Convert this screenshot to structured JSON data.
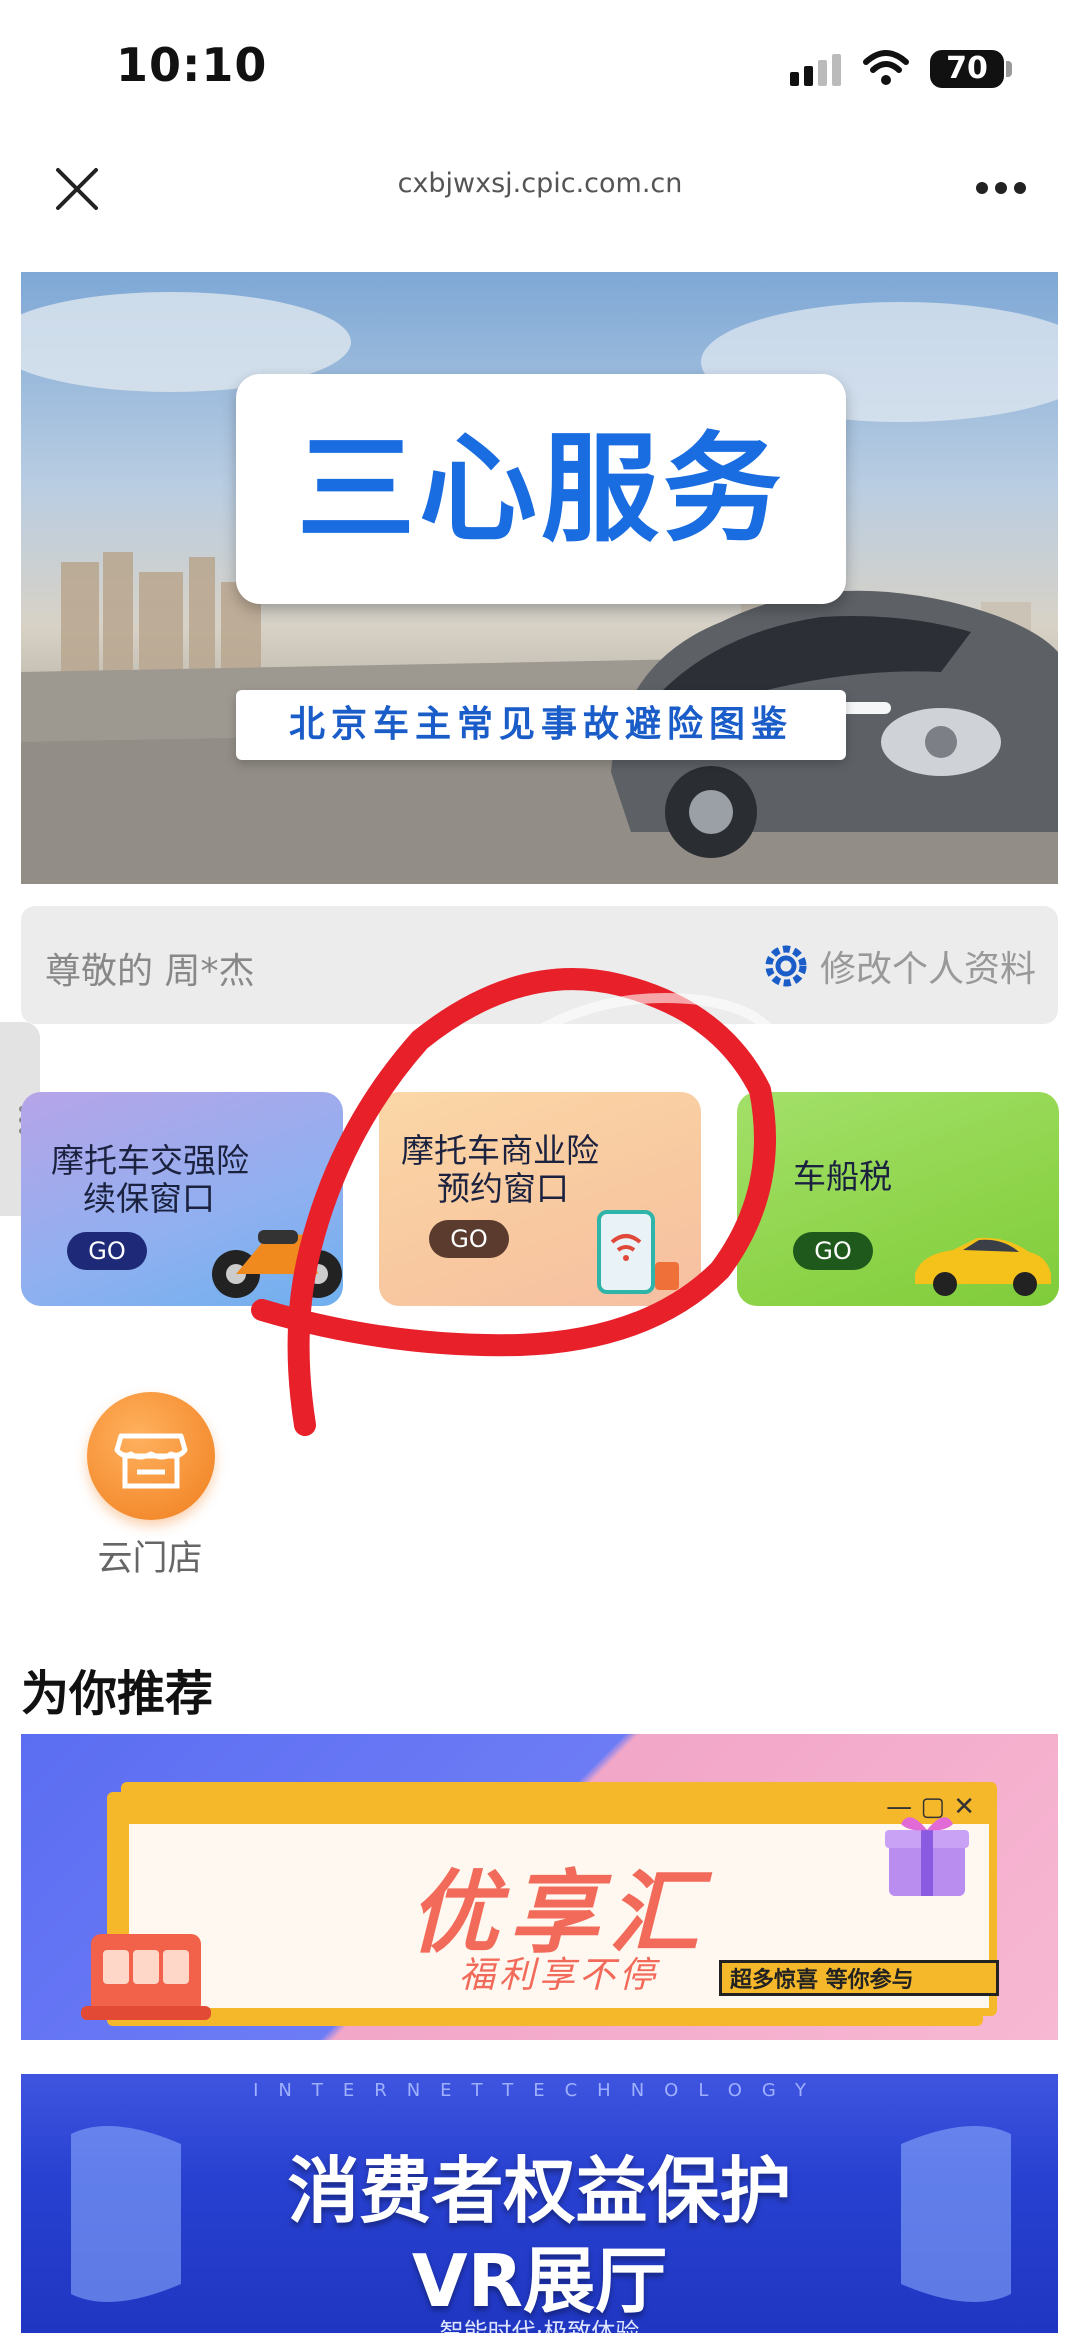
{
  "status_bar": {
    "time": "10:10",
    "battery": "70"
  },
  "browser": {
    "url": "cxbjwxsj.cpic.com.cn"
  },
  "hero": {
    "title": "三心服务",
    "subtitle": "北京车主常见事故避险图鉴"
  },
  "greeting": {
    "text": "尊敬的 周*杰",
    "profile_link": "修改个人资料"
  },
  "cards": [
    {
      "label_line1": "摩托车交强险",
      "label_line2": "续保窗口",
      "go": "GO"
    },
    {
      "label_line1": "摩托车商业险",
      "label_line2": "预约窗口",
      "go": "GO"
    },
    {
      "label_line1": "车船税",
      "label_line2": "",
      "go": "GO"
    }
  ],
  "store": {
    "label": "云门店"
  },
  "section": {
    "title": "为你推荐"
  },
  "promo": {
    "title": "优享汇",
    "subtitle": "福利享不停",
    "tag": "超多惊喜 等你参与"
  },
  "vr": {
    "strip": "INTERNETTECHNOLOGY",
    "title_line1": "消费者权益保护",
    "title_line2": "VR展厅",
    "subtitle": "智能时代·极致体验"
  },
  "colors": {
    "accent_blue": "#1a6de0",
    "annotation_red": "#e8202a"
  }
}
